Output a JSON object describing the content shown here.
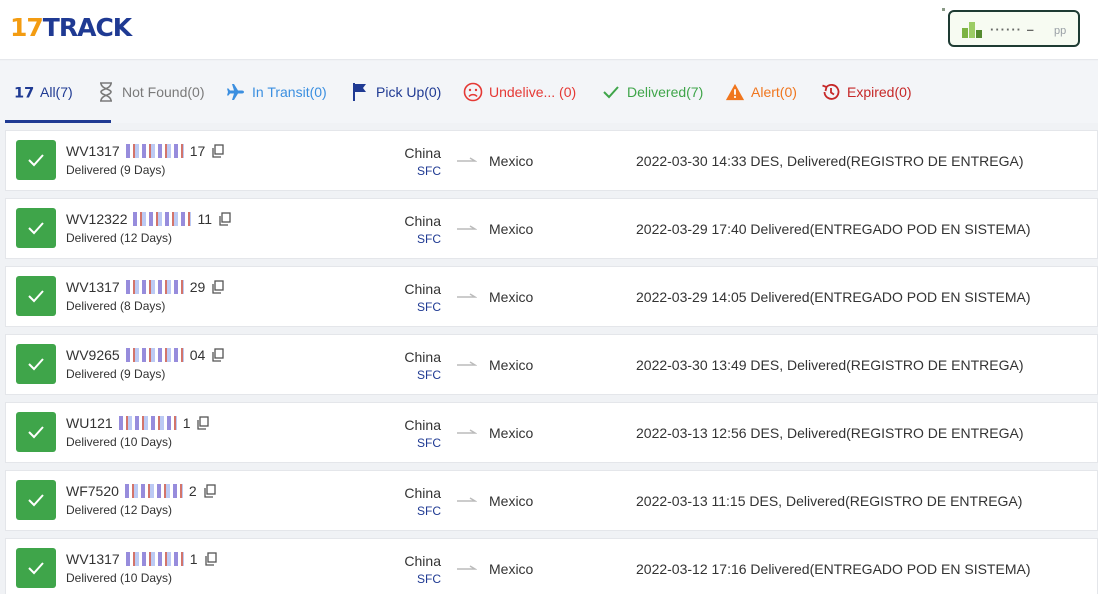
{
  "header": {
    "logo_num": "17",
    "logo_text": "TRACK",
    "app_button_label": "······ –",
    "app_button_suffix": "pp"
  },
  "tabs": [
    {
      "label": "All(7)",
      "icon": "17-logo-icon",
      "color": "#1f3a93"
    },
    {
      "label": "Not Found(0)",
      "icon": "hourglass-icon",
      "color": "#7a7a7a"
    },
    {
      "label": "In Transit(0)",
      "icon": "airplane-icon",
      "color": "#3b8fe0"
    },
    {
      "label": "Pick Up(0)",
      "icon": "flag-icon",
      "color": "#1f3a93"
    },
    {
      "label": "Undelive... (0)",
      "icon": "sad-face-icon",
      "color": "#e53935"
    },
    {
      "label": "Delivered(7)",
      "icon": "checkmark-icon",
      "color": "#3fa54a"
    },
    {
      "label": "Alert(0)",
      "icon": "warning-triangle-icon",
      "color": "#f0761e"
    },
    {
      "label": "Expired(0)",
      "icon": "history-clock-icon",
      "color": "#c62828"
    }
  ],
  "shipments": [
    {
      "prefix": "WV1317",
      "suffix": "17",
      "days": "Delivered (9 Days)",
      "origin": "China",
      "carrier": "SFC",
      "destination": "Mexico",
      "event": "2022-03-30 14:33  DES, Delivered(REGISTRO DE ENTREGA)"
    },
    {
      "prefix": "WV12322",
      "suffix": "11",
      "days": "Delivered (12 Days)",
      "origin": "China",
      "carrier": "SFC",
      "destination": "Mexico",
      "event": "2022-03-29 17:40  Delivered(ENTREGADO POD EN SISTEMA)"
    },
    {
      "prefix": "WV1317",
      "suffix": "29",
      "days": "Delivered (8 Days)",
      "origin": "China",
      "carrier": "SFC",
      "destination": "Mexico",
      "event": "2022-03-29 14:05  Delivered(ENTREGADO POD EN SISTEMA)"
    },
    {
      "prefix": "WV9265",
      "suffix": "04",
      "days": "Delivered (9 Days)",
      "origin": "China",
      "carrier": "SFC",
      "destination": "Mexico",
      "event": "2022-03-30 13:49  DES, Delivered(REGISTRO DE ENTREGA)"
    },
    {
      "prefix": "WU121",
      "suffix": "1",
      "days": "Delivered (10 Days)",
      "origin": "China",
      "carrier": "SFC",
      "destination": "Mexico",
      "event": "2022-03-13 12:56  DES, Delivered(REGISTRO DE ENTREGA)"
    },
    {
      "prefix": "WF7520",
      "suffix": "2",
      "days": "Delivered (12 Days)",
      "origin": "China",
      "carrier": "SFC",
      "destination": "Mexico",
      "event": "2022-03-13 11:15  DES, Delivered(REGISTRO DE ENTREGA)"
    },
    {
      "prefix": "WV1317",
      "suffix": "1",
      "days": "Delivered (10 Days)",
      "origin": "China",
      "carrier": "SFC",
      "destination": "Mexico",
      "event": "2022-03-12 17:16  Delivered(ENTREGADO POD EN SISTEMA)"
    }
  ],
  "colors": {
    "brand_navy": "#1f3a93",
    "brand_orange": "#f39c12",
    "delivered_green": "#3fa54a"
  }
}
